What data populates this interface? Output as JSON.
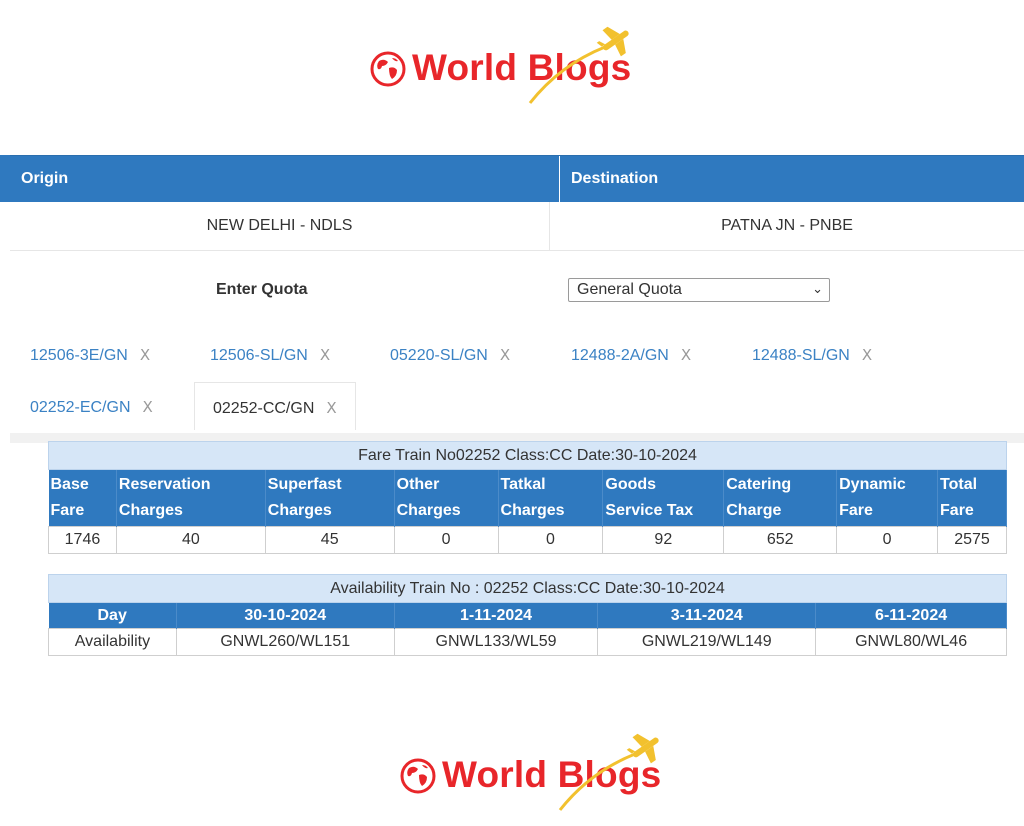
{
  "brand": {
    "name": "World Blogs",
    "colors": {
      "red": "#e8262a",
      "gold": "#f2c12e",
      "header_blue": "#2f79bf"
    }
  },
  "journey": {
    "origin_label": "Origin",
    "destination_label": "Destination",
    "origin_value": "NEW DELHI - NDLS",
    "destination_value": "PATNA JN - PNBE"
  },
  "quota": {
    "label": "Enter Quota",
    "selected": "General Quota"
  },
  "tabs": [
    {
      "label": "12506-3E/GN",
      "close": "X"
    },
    {
      "label": "12506-SL/GN",
      "close": "X"
    },
    {
      "label": "05220-SL/GN",
      "close": "X"
    },
    {
      "label": "12488-2A/GN",
      "close": "X"
    },
    {
      "label": "12488-SL/GN",
      "close": "X"
    },
    {
      "label": "02252-EC/GN",
      "close": "X"
    },
    {
      "label": "02252-CC/GN",
      "close": "X",
      "active": true
    }
  ],
  "fare": {
    "caption": "Fare Train No02252  Class:CC  Date:30-10-2024",
    "headers": [
      [
        "Base",
        "Fare"
      ],
      [
        "Reservation",
        "Charges"
      ],
      [
        "Superfast",
        "Charges"
      ],
      [
        "Other",
        "Charges"
      ],
      [
        "Tatkal",
        "Charges"
      ],
      [
        "Goods",
        "Service Tax"
      ],
      [
        "Catering",
        "Charge"
      ],
      [
        "Dynamic",
        "Fare"
      ],
      [
        "Total",
        "Fare"
      ]
    ],
    "values": [
      "1746",
      "40",
      "45",
      "0",
      "0",
      "92",
      "652",
      "0",
      "2575"
    ]
  },
  "availability": {
    "caption": "Availability Train No : 02252  Class:CC  Date:30-10-2024",
    "day_label": "Day",
    "row_label": "Availability",
    "dates": [
      "30-10-2024",
      "1-11-2024",
      "3-11-2024",
      "6-11-2024"
    ],
    "values": [
      "GNWL260/WL151",
      "GNWL133/WL59",
      "GNWL219/WL149",
      "GNWL80/WL46"
    ]
  }
}
